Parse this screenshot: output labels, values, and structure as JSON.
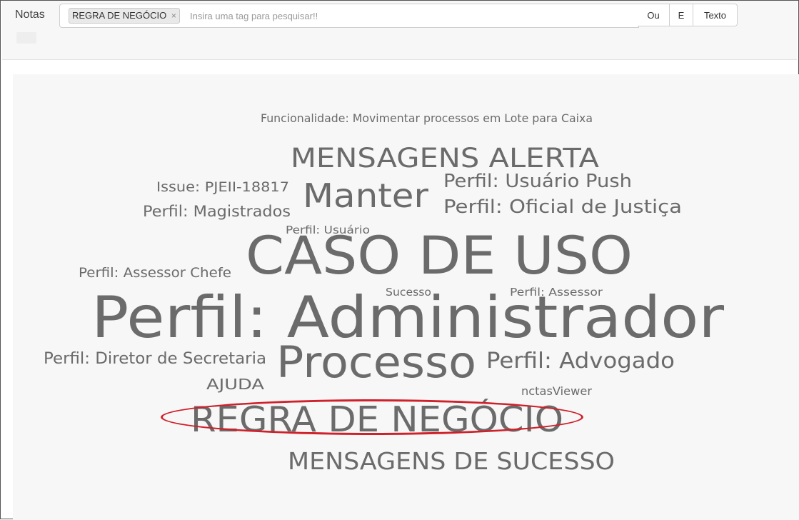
{
  "app": {
    "title": "Notas"
  },
  "search": {
    "tags": [
      {
        "label": "REGRA DE NEGÓCIO",
        "remove": "×"
      }
    ],
    "placeholder": "Insira uma tag para pesquisar!!",
    "value": ""
  },
  "buttons": {
    "or": "Ou",
    "and": "E",
    "text": "Texto"
  },
  "cloud": {
    "words": [
      "Funcionalidade: Movimentar processos em Lote para Caixa",
      "MENSAGENS ALERTA",
      "Issue: PJEII-18817",
      "Manter",
      "Perfil: Usuário Push",
      "Perfil: Oficial de Justiça",
      "Perfil: Magistrados",
      "Perfil: Usuário",
      "CASO DE USO",
      "Perfil: Assessor Chefe",
      "Sucesso",
      "Perfil: Assessor",
      "Perfil: Administrador",
      "Perfil: Diretor de Secretaria",
      "Processo",
      "Perfil: Advogado",
      "AJUDA",
      "nctasViewer",
      "REGRA DE NEGÓCIO",
      "MENSAGENS DE SUCESSO"
    ],
    "highlight_color": "#d0202a",
    "word_color": "#6b6b6b"
  }
}
